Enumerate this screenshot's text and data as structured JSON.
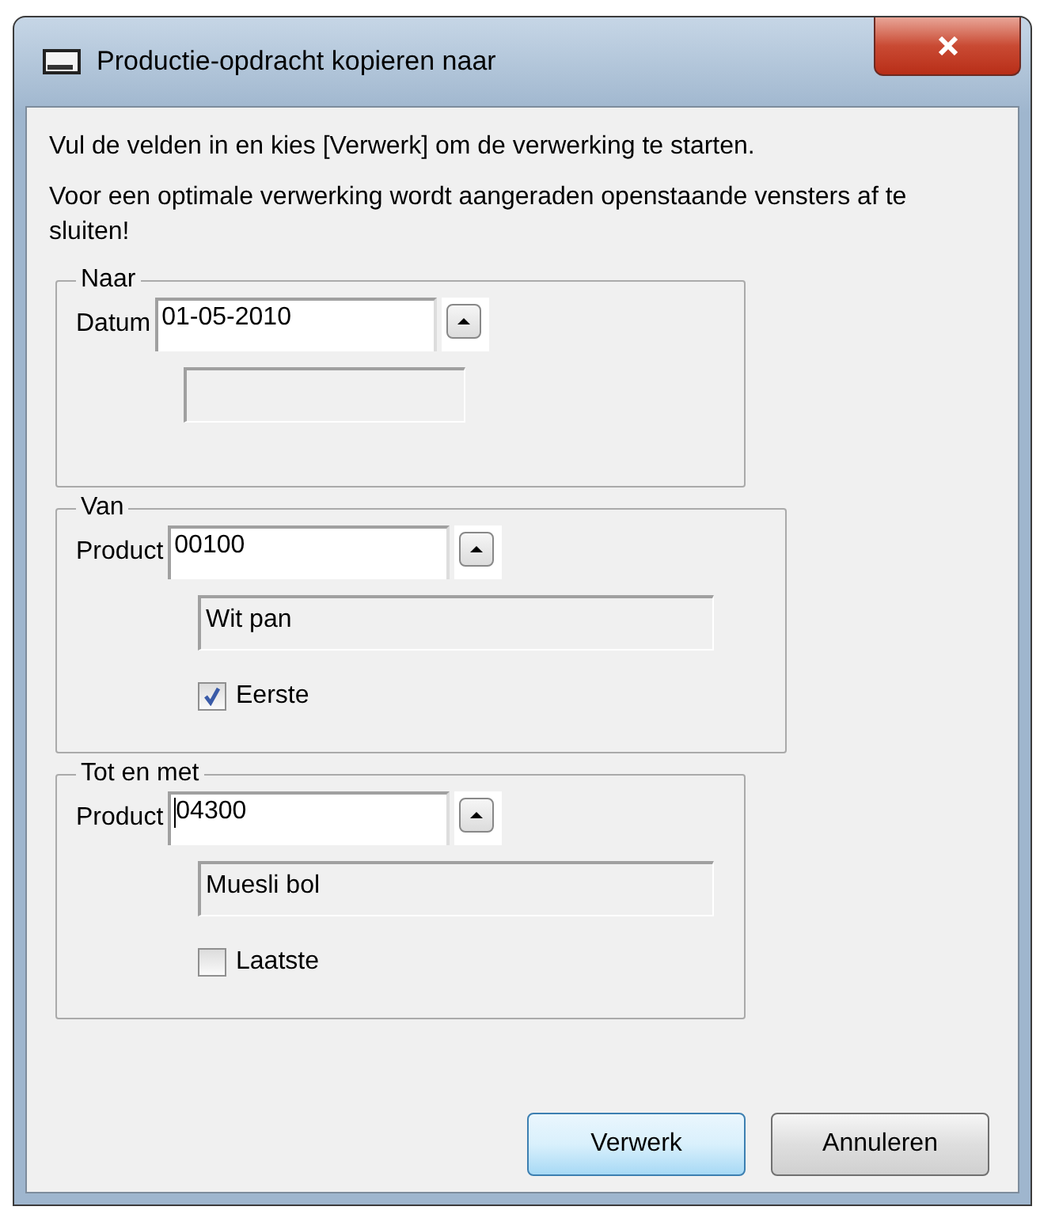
{
  "window": {
    "title": "Productie-opdracht kopieren naar"
  },
  "instructions": [
    "Vul de velden in en kies [Verwerk] om de verwerking te starten.",
    "Voor een optimale verwerking wordt aangeraden openstaande vensters af te sluiten!"
  ],
  "groups": [
    {
      "legend": "Naar",
      "field": {
        "label": "Datum",
        "value": "01-05-2010",
        "focused": false
      }
    },
    {
      "legend": "Van",
      "field": {
        "label": "Product",
        "value": "00100",
        "focused": false
      },
      "description": "Wit pan",
      "checkbox": {
        "label": "Eerste",
        "checked": true
      }
    },
    {
      "legend": "Tot en met",
      "field": {
        "label": "Product",
        "value": "04300",
        "focused": true
      },
      "description": "Muesli bol",
      "checkbox": {
        "label": "Laatste",
        "checked": false
      }
    }
  ],
  "buttons": [
    {
      "label": "Verwerk",
      "default": true
    },
    {
      "label": "Annuleren",
      "default": false
    }
  ]
}
